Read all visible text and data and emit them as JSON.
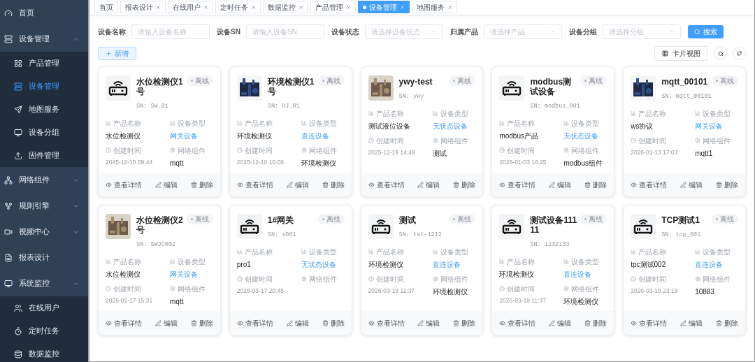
{
  "sidebar": {
    "items": [
      {
        "label": "首页",
        "selected": false
      },
      {
        "label": "设备管理",
        "expanded": true,
        "selected": false,
        "children": [
          {
            "label": "产品管理",
            "selected": false
          },
          {
            "label": "设备管理",
            "selected": true
          },
          {
            "label": "地图服务",
            "selected": false
          },
          {
            "label": "设备分组",
            "selected": false
          },
          {
            "label": "固件管理",
            "selected": false
          }
        ]
      },
      {
        "label": "网络组件",
        "expanded": false,
        "selected": false
      },
      {
        "label": "规则引擎",
        "expanded": false,
        "selected": false
      },
      {
        "label": "视频中心",
        "expanded": false,
        "selected": false
      },
      {
        "label": "报表设计",
        "selected": false
      },
      {
        "label": "系统监控",
        "expanded": true,
        "selected": false,
        "children": [
          {
            "label": "在线用户",
            "selected": false
          },
          {
            "label": "定时任务",
            "selected": false
          },
          {
            "label": "数据监控",
            "selected": false
          }
        ]
      }
    ]
  },
  "tabs": [
    {
      "label": "首页",
      "closable": false,
      "selected": false
    },
    {
      "label": "报表设计",
      "closable": true,
      "selected": false
    },
    {
      "label": "在线用户",
      "closable": true,
      "selected": false
    },
    {
      "label": "定时任务",
      "closable": true,
      "selected": false
    },
    {
      "label": "数据监控",
      "closable": true,
      "selected": false
    },
    {
      "label": "产品管理",
      "closable": true,
      "selected": false
    },
    {
      "label": "设备管理",
      "closable": true,
      "selected": true
    },
    {
      "label": "地图服务",
      "closable": true,
      "selected": false
    }
  ],
  "filters": [
    {
      "label": "设备名称",
      "kind": "input",
      "placeholder": "请输入设备名称"
    },
    {
      "label": "设备SN",
      "kind": "input",
      "placeholder": "请输入设备SN"
    },
    {
      "label": "设备状态",
      "kind": "select",
      "placeholder": "请选择设备状态"
    },
    {
      "label": "归属产品",
      "kind": "select",
      "placeholder": "请选择产品"
    },
    {
      "label": "设备分组",
      "kind": "select",
      "placeholder": "请选择分组"
    }
  ],
  "search_button": "搜索",
  "add_button": "新增",
  "view_button": "卡片视图",
  "devices": [
    {
      "name": "水位检测仪1号",
      "sn": "SN: SW_01",
      "status": "离线",
      "kind": "gateway",
      "fields": [
        {
          "label": "产品名称",
          "kind": "text",
          "value": "水位检测仪"
        },
        {
          "label": "设备类型",
          "kind": "link",
          "value": "网关设备"
        },
        {
          "label": "创建时间",
          "kind": "time",
          "value": "2025-12-10 09:44"
        },
        {
          "label": "网络组件",
          "kind": "text",
          "value": "mqtt"
        }
      ],
      "actions": [
        "查看详情",
        "编辑",
        "删除"
      ]
    },
    {
      "name": "环境检测仪1号",
      "sn": "SN: HJ_01",
      "status": "离线",
      "kind": "picture",
      "fields": [
        {
          "label": "产品名称",
          "kind": "text",
          "value": "环境检测仪"
        },
        {
          "label": "设备类型",
          "kind": "link",
          "value": "直连设备"
        },
        {
          "label": "创建时间",
          "kind": "time",
          "value": "2025-12-10 10:06"
        },
        {
          "label": "网络组件",
          "kind": "text",
          "value": "环境检测仪"
        }
      ],
      "actions": [
        "查看详情",
        "编辑",
        "删除"
      ]
    },
    {
      "name": "ywy-test",
      "sn": "SN: ywy",
      "status": "离线",
      "kind": "picture",
      "fields": [
        {
          "label": "产品名称",
          "kind": "text",
          "value": "测试液位设备"
        },
        {
          "label": "设备类型",
          "kind": "link",
          "value": "无状态设备"
        },
        {
          "label": "创建时间",
          "kind": "time",
          "value": "2025-12-19 14:49"
        },
        {
          "label": "网络组件",
          "kind": "text",
          "value": "测试"
        }
      ],
      "actions": [
        "查看详情",
        "编辑",
        "删除"
      ]
    },
    {
      "name": "modbus测试设备",
      "sn": "SN: modbus_001",
      "status": "离线",
      "kind": "gateway",
      "fields": [
        {
          "label": "产品名称",
          "kind": "text",
          "value": "modbus产品"
        },
        {
          "label": "设备类型",
          "kind": "link",
          "value": "无状态设备"
        },
        {
          "label": "创建时间",
          "kind": "time",
          "value": "2026-01-03 16:25"
        },
        {
          "label": "网络组件",
          "kind": "text",
          "value": "modbus组件"
        }
      ],
      "actions": [
        "查看详情",
        "编辑",
        "删除"
      ]
    },
    {
      "name": "mqtt_00101",
      "sn": "SN: mqtt_00101",
      "status": "离线",
      "kind": "picture",
      "fields": [
        {
          "label": "产品名称",
          "kind": "text",
          "value": "ws协议"
        },
        {
          "label": "设备类型",
          "kind": "link",
          "value": "网关设备"
        },
        {
          "label": "创建时间",
          "kind": "time",
          "value": "2026-01-13 17:03"
        },
        {
          "label": "网络组件",
          "kind": "text",
          "value": "mqtt1"
        }
      ],
      "actions": [
        "查看详情",
        "编辑",
        "删除"
      ]
    },
    {
      "name": "水位检测仪2号",
      "sn": "SN: SWJC002",
      "status": "离线",
      "kind": "picture",
      "fields": [
        {
          "label": "产品名称",
          "kind": "text",
          "value": "水位检测仪"
        },
        {
          "label": "设备类型",
          "kind": "link",
          "value": "网关设备"
        },
        {
          "label": "创建时间",
          "kind": "time",
          "value": "2026-01-17 15:31"
        },
        {
          "label": "网络组件",
          "kind": "text",
          "value": "mqtt"
        }
      ],
      "actions": [
        "查看详情",
        "编辑",
        "删除"
      ]
    },
    {
      "name": "1#网关",
      "sn": "SN: s001",
      "status": "离线",
      "kind": "gateway",
      "fields": [
        {
          "label": "产品名称",
          "kind": "text",
          "value": "pro1"
        },
        {
          "label": "设备类型",
          "kind": "link",
          "value": "无状态设备"
        },
        {
          "label": "创建时间",
          "kind": "time",
          "value": "2026-03-17 20:45"
        },
        {
          "label": "网络组件"
        }
      ],
      "actions": [
        "查看详情",
        "编辑",
        "删除"
      ]
    },
    {
      "name": "测试",
      "sn": "SN: tst-1212",
      "status": "离线",
      "kind": "gateway",
      "fields": [
        {
          "label": "产品名称",
          "kind": "text",
          "value": "环境检测仪"
        },
        {
          "label": "设备类型",
          "kind": "link",
          "value": "直连设备"
        },
        {
          "label": "创建时间",
          "kind": "time",
          "value": "2026-03-19 11:37"
        },
        {
          "label": "网络组件",
          "kind": "text",
          "value": "环境检测仪"
        }
      ],
      "actions": [
        "查看详情",
        "编辑",
        "删除"
      ]
    },
    {
      "name": "测试设备11111",
      "sn": "SN: 1232133",
      "status": "离线",
      "kind": "gateway",
      "fields": [
        {
          "label": "产品名称",
          "kind": "text",
          "value": "环境检测仪"
        },
        {
          "label": "设备类型",
          "kind": "link",
          "value": "直连设备"
        },
        {
          "label": "创建时间",
          "kind": "time",
          "value": "2026-03-19 11:37"
        },
        {
          "label": "网络组件",
          "kind": "text",
          "value": "环境检测仪"
        }
      ],
      "actions": [
        "查看详情",
        "编辑",
        "删除"
      ]
    },
    {
      "name": "TCP测试1",
      "sn": "SN: tcp_001",
      "status": "离线",
      "kind": "gateway",
      "fields": [
        {
          "label": "产品名称",
          "kind": "text",
          "value": "tpc测试002"
        },
        {
          "label": "设备类型",
          "kind": "link",
          "value": "直连设备"
        },
        {
          "label": "创建时间",
          "kind": "time",
          "value": "2026-03-19 23:19"
        },
        {
          "label": "网络组件",
          "kind": "text",
          "value": "10883"
        }
      ],
      "actions": [
        "查看详情",
        "编辑",
        "删除"
      ]
    }
  ]
}
